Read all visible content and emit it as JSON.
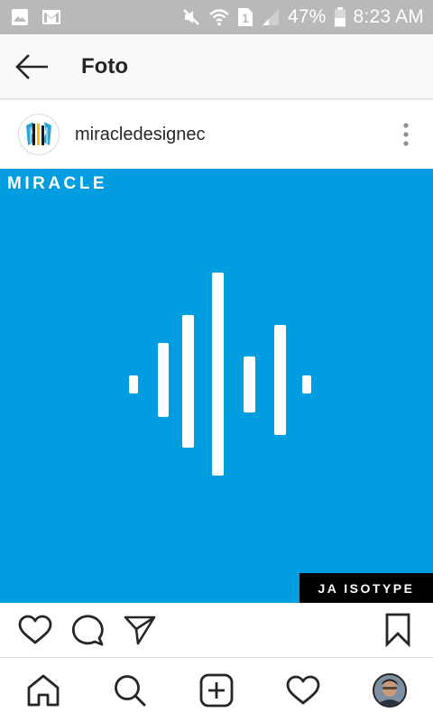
{
  "status_bar": {
    "battery_percent": "47%",
    "time": "8:23 AM",
    "sim_label": "1",
    "icons": [
      "gallery-icon",
      "gmail-icon",
      "mute-icon",
      "wifi-icon",
      "sim-icon",
      "signal-icon",
      "battery-icon"
    ]
  },
  "header": {
    "title": "Foto",
    "back_icon": "arrow-left-icon"
  },
  "post": {
    "username": "miracledesignec",
    "more_icon": "more-vertical-icon",
    "image": {
      "brand_text": "MIRACLE",
      "caption": "JA ISOTYPE",
      "background_color": "#009de0"
    }
  },
  "actions": {
    "items": [
      "heart-icon",
      "comment-icon",
      "share-icon",
      "bookmark-icon"
    ]
  },
  "bottom_nav": {
    "items": [
      "home-icon",
      "search-icon",
      "add-icon",
      "activity-heart-icon",
      "profile-avatar"
    ]
  },
  "colors": {
    "status_bar_bg": "#b9b9b9",
    "text_primary": "#262626",
    "accent_blue": "#009de0"
  }
}
